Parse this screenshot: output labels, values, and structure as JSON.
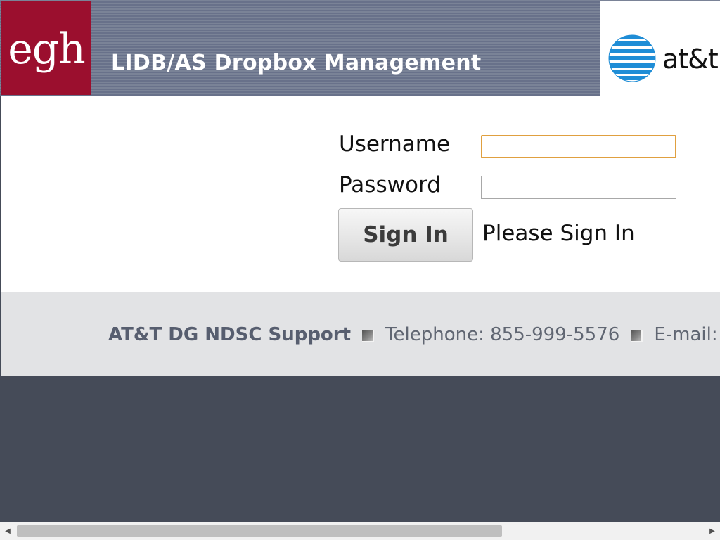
{
  "header": {
    "logo_text": "egh",
    "title": "LIDB/AS Dropbox Management",
    "partner_logo_text": "at&t"
  },
  "login": {
    "username_label": "Username",
    "username_value": "",
    "password_label": "Password",
    "password_value": "",
    "signin_label": "Sign In",
    "status_text": "Please Sign In"
  },
  "footer": {
    "support_title": "AT&T DG NDSC Support",
    "telephone": "Telephone: 855-999-5576",
    "email": "E-mail: a"
  },
  "colors": {
    "egh_brand": "#9b0f2e",
    "header_band": "#6e778b",
    "att_blue": "#1f8dd6",
    "input_focus": "#e0a040",
    "page_background": "#454b58",
    "footer_background": "#e2e3e5"
  },
  "icons": {
    "partner_logo": "att-globe-icon",
    "separator": "square-bullet-icon",
    "scroll_left": "arrow-left-icon",
    "scroll_right": "arrow-right-icon"
  }
}
